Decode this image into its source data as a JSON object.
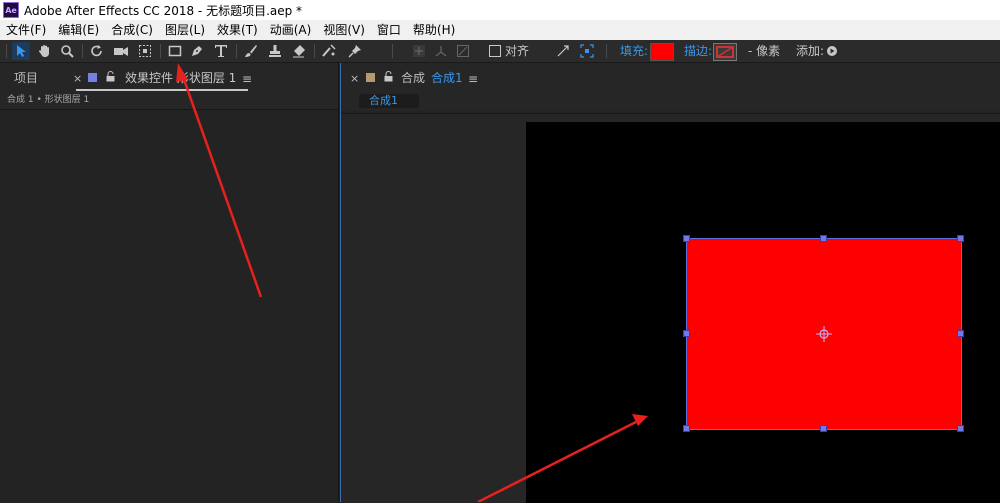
{
  "window": {
    "title": "Adobe After Effects CC 2018 - 无标题项目.aep *",
    "logo_text": "Ae"
  },
  "menu": [
    "文件(F)",
    "编辑(E)",
    "合成(C)",
    "图层(L)",
    "效果(T)",
    "动画(A)",
    "视图(V)",
    "窗口",
    "帮助(H)"
  ],
  "toolbar": {
    "align_label": "对齐",
    "fill_label": "填充:",
    "stroke_label": "描边:",
    "pixel_label": "- 像素",
    "add_label": "添加:",
    "fill_color": "#ff0000",
    "stroke_color": "#cc3333"
  },
  "left_panel": {
    "project_tab": "项目",
    "close_glyph": "×",
    "effects_tab": "效果控件 形状图层 1",
    "menu_glyph": "≡",
    "breadcrumb": "合成 1 • 形状图层 1"
  },
  "right_panel": {
    "close_glyph": "×",
    "tab_prefix": "合成",
    "tab_name": "合成1",
    "menu_glyph": "≡",
    "comp_chip": "合成1"
  },
  "canvas": {
    "background": "#000000",
    "shape_color": "#ff0000",
    "handle_color": "#7278e6"
  },
  "annotation": {
    "arrow_color": "#e8201e"
  }
}
